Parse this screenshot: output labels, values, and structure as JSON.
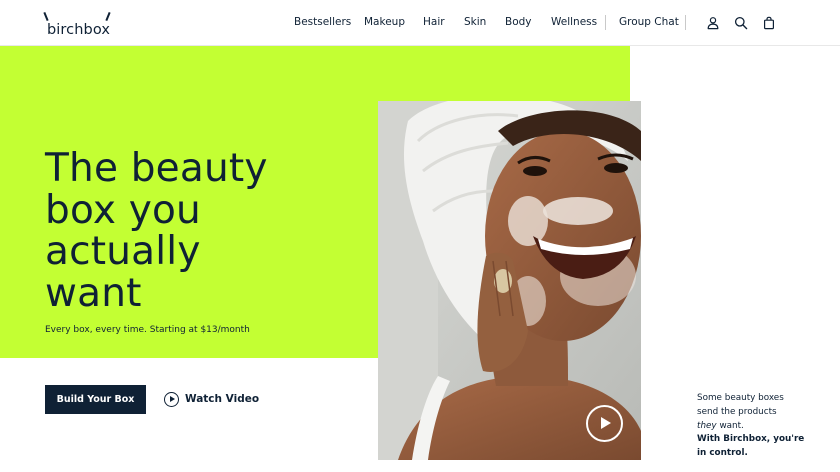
{
  "brand": {
    "logo_text": "birchbox"
  },
  "nav": {
    "items": [
      "Bestsellers",
      "Makeup",
      "Hair",
      "Skin",
      "Body",
      "Wellness"
    ],
    "group_chat": "Group Chat"
  },
  "header_icons": [
    "account-icon",
    "search-icon",
    "bag-icon"
  ],
  "hero": {
    "headline_lines": [
      "The beauty",
      "box you",
      "actually",
      "want"
    ],
    "subline": "Every box, every time. Starting at $13/month",
    "build_button": "Build Your Box",
    "watch_video": "Watch Video"
  },
  "side_note": {
    "line1": "Some beauty boxes",
    "line2": "send the products",
    "line3_italic": "they",
    "line3_rest": " want.",
    "bold_line1": "With Birchbox, you're",
    "bold_line2": "in control."
  },
  "colors": {
    "accent_green": "#c3ff33",
    "navy": "#0f2135",
    "white": "#ffffff"
  }
}
